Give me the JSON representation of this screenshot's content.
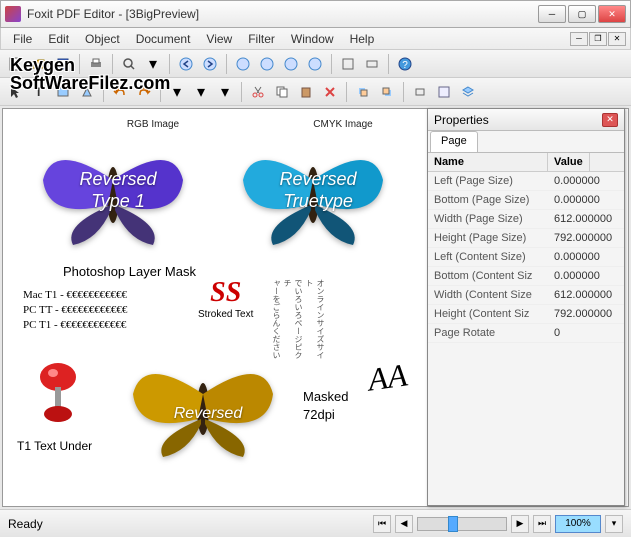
{
  "window": {
    "title": "Foxit PDF Editor - [3BigPreview]"
  },
  "menu": {
    "items": [
      "File",
      "Edit",
      "Object",
      "Document",
      "View",
      "Filter",
      "Window",
      "Help"
    ]
  },
  "watermark": {
    "line1": "Keygen",
    "line2": "SoftWareFilez.com"
  },
  "canvas": {
    "rgb_label": "RGB Image",
    "cmyk_label": "CMYK Image",
    "reversed_type1": "Reversed\nType 1",
    "reversed_truetype": "Reversed\nTruetype",
    "photoshop_mask": "Photoshop Layer Mask",
    "mac_t1": "Mac T1 - €€€€€€€€€€€",
    "pc_tt": "PC TT - €€€€€€€€€€€€",
    "pc_t1": "PC T1 - €€€€€€€€€€€€",
    "ss": "SS",
    "stroked": "Stroked Text",
    "reversed_bottom": "Reversed",
    "masked": "Masked",
    "dpi": "72dpi",
    "t1_under": "T1 Text Under",
    "aaa": "AA"
  },
  "properties": {
    "title": "Properties",
    "tab": "Page",
    "header_name": "Name",
    "header_value": "Value",
    "rows": [
      {
        "name": "Left (Page Size)",
        "value": "0.000000"
      },
      {
        "name": "Bottom (Page Size)",
        "value": "0.000000"
      },
      {
        "name": "Width (Page Size)",
        "value": "612.000000"
      },
      {
        "name": "Height (Page Size)",
        "value": "792.000000"
      },
      {
        "name": "Left (Content Size)",
        "value": "0.000000"
      },
      {
        "name": "Bottom (Content Siz",
        "value": "0.000000"
      },
      {
        "name": "Width (Content Size",
        "value": "612.000000"
      },
      {
        "name": "Height (Content Siz",
        "value": "792.000000"
      },
      {
        "name": "Page Rotate",
        "value": "0"
      }
    ]
  },
  "status": {
    "text": "Ready",
    "zoom": "100%"
  }
}
